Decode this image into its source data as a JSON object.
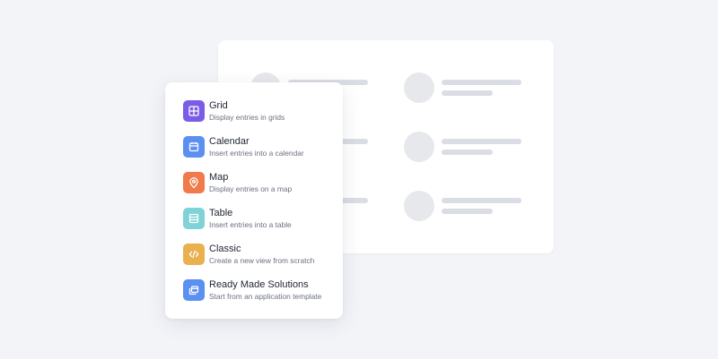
{
  "menu": {
    "items": [
      {
        "title": "Grid",
        "subtitle": "Display entries in grids",
        "icon": "grid-icon",
        "color": "#7b5ce6"
      },
      {
        "title": "Calendar",
        "subtitle": "Insert entries into a calendar",
        "icon": "calendar-icon",
        "color": "#5b8ff0"
      },
      {
        "title": "Map",
        "subtitle": "Display entries on a map",
        "icon": "map-pin-icon",
        "color": "#f07a4a"
      },
      {
        "title": "Table",
        "subtitle": "Insert entries into a table",
        "icon": "table-icon",
        "color": "#7fd3d6"
      },
      {
        "title": "Classic",
        "subtitle": "Create a new view from scratch",
        "icon": "code-icon",
        "color": "#e8b04f"
      },
      {
        "title": "Ready Made Solutions",
        "subtitle": "Start from an application template",
        "icon": "template-icon",
        "color": "#5b8ff0"
      }
    ]
  }
}
